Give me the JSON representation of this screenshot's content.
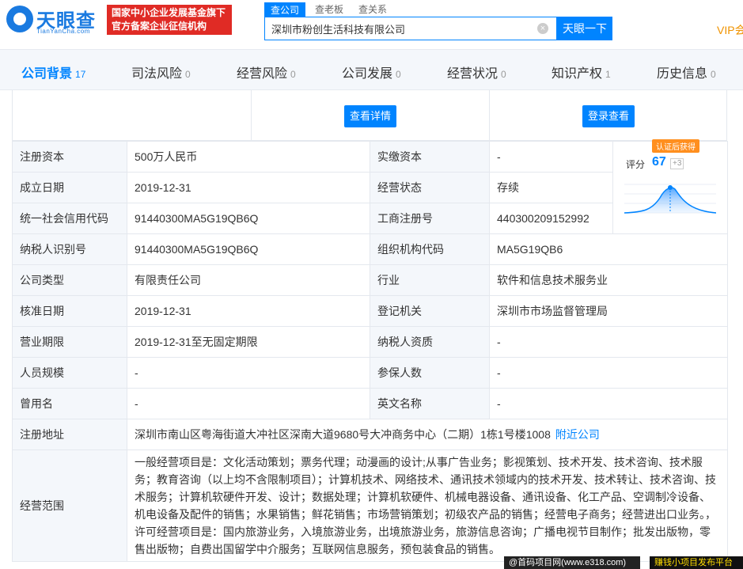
{
  "header": {
    "logo_text": "天眼查",
    "logo_sub": "TianYanCha.com",
    "badge_line1": "国家中小企业发展基金旗下",
    "badge_line2": "官方备案企业征信机构",
    "search_tabs": [
      "查公司",
      "查老板",
      "查关系"
    ],
    "search_value": "深圳市粉创生活科技有限公司",
    "search_button": "天眼一下",
    "vip": "VIP会"
  },
  "nav": [
    {
      "label": "公司背景",
      "count": "17"
    },
    {
      "label": "司法风险",
      "count": "0"
    },
    {
      "label": "经营风险",
      "count": "0"
    },
    {
      "label": "公司发展",
      "count": "0"
    },
    {
      "label": "经营状况",
      "count": "0"
    },
    {
      "label": "知识产权",
      "count": "1"
    },
    {
      "label": "历史信息",
      "count": "0"
    }
  ],
  "top_cards": {
    "detail_button": "查看详情",
    "login_button": "登录查看"
  },
  "score": {
    "tag": "认证后获得",
    "label": "评分",
    "value": "67",
    "delta": "+3"
  },
  "info": {
    "reg_capital_label": "注册资本",
    "reg_capital": "500万人民币",
    "paid_capital_label": "实缴资本",
    "paid_capital": "-",
    "found_date_label": "成立日期",
    "found_date": "2019-12-31",
    "status_label": "经营状态",
    "status": "存续",
    "credit_code_label": "统一社会信用代码",
    "credit_code": "91440300MA5G19QB6Q",
    "biz_reg_label": "工商注册号",
    "biz_reg": "440300209152992",
    "tax_id_label": "纳税人识别号",
    "tax_id": "91440300MA5G19QB6Q",
    "org_code_label": "组织机构代码",
    "org_code": "MA5G19QB6",
    "company_type_label": "公司类型",
    "company_type": "有限责任公司",
    "industry_label": "行业",
    "industry": "软件和信息技术服务业",
    "approve_date_label": "核准日期",
    "approve_date": "2019-12-31",
    "reg_authority_label": "登记机关",
    "reg_authority": "深圳市市场监督管理局",
    "biz_term_label": "营业期限",
    "biz_term": "2019-12-31至无固定期限",
    "taxpayer_qual_label": "纳税人资质",
    "taxpayer_qual": "-",
    "staff_size_label": "人员规模",
    "staff_size": "-",
    "insured_label": "参保人数",
    "insured": "-",
    "former_name_label": "曾用名",
    "former_name": "-",
    "english_name_label": "英文名称",
    "english_name": "-",
    "address_label": "注册地址",
    "address": "深圳市南山区粤海街道大冲社区深南大道9680号大冲商务中心（二期）1栋1号楼1008",
    "nearby_link": "附近公司",
    "scope_label": "经营范围",
    "scope": "一般经营项目是：文化活动策划；票务代理；动漫画的设计;从事广告业务；影视策划、技术开发、技术咨询、技术服务；教育咨询（以上均不含限制项目）；计算机技术、网络技术、通讯技术领域内的技术开发、技术转让、技术咨询、技术服务；计算机软硬件开发、设计；数据处理；计算机软硬件、机械电器设备、通讯设备、化工产品、空调制冷设备、机电设备及配件的销售；水果销售；鲜花销售；市场营销策划；初级农产品的销售；经营电子商务；经营进出口业务。，许可经营项目是：国内旅游业务，入境旅游业务，出境旅游业务，旅游信息咨询；广播电视节目制作；批发出版物，零售出版物；自费出国留学中介服务；互联网信息服务，预包装食品的销售。"
  },
  "watermark": {
    "left": "@首码项目网(www.e318.com)",
    "right": "赚钱小项目发布平台"
  }
}
